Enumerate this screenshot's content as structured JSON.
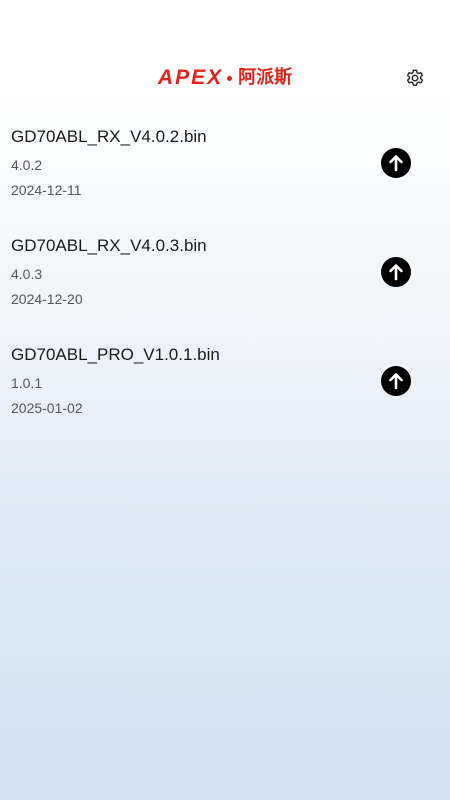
{
  "header": {
    "brand_latin": "APEX",
    "brand_cn": "阿派斯",
    "settings_icon": "gear-icon"
  },
  "firmware_list": [
    {
      "name": "GD70ABL_RX_V4.0.2.bin",
      "version": "4.0.2",
      "date": "2024-12-11",
      "action_icon": "upload-arrow-icon"
    },
    {
      "name": "GD70ABL_RX_V4.0.3.bin",
      "version": "4.0.3",
      "date": "2024-12-20",
      "action_icon": "upload-arrow-icon"
    },
    {
      "name": "GD70ABL_PRO_V1.0.1.bin",
      "version": "1.0.1",
      "date": "2025-01-02",
      "action_icon": "upload-arrow-icon"
    }
  ],
  "colors": {
    "brand_red": "#e2231a",
    "text_primary": "#1a1a1a",
    "text_secondary": "#555555",
    "upload_button": "#000000"
  }
}
